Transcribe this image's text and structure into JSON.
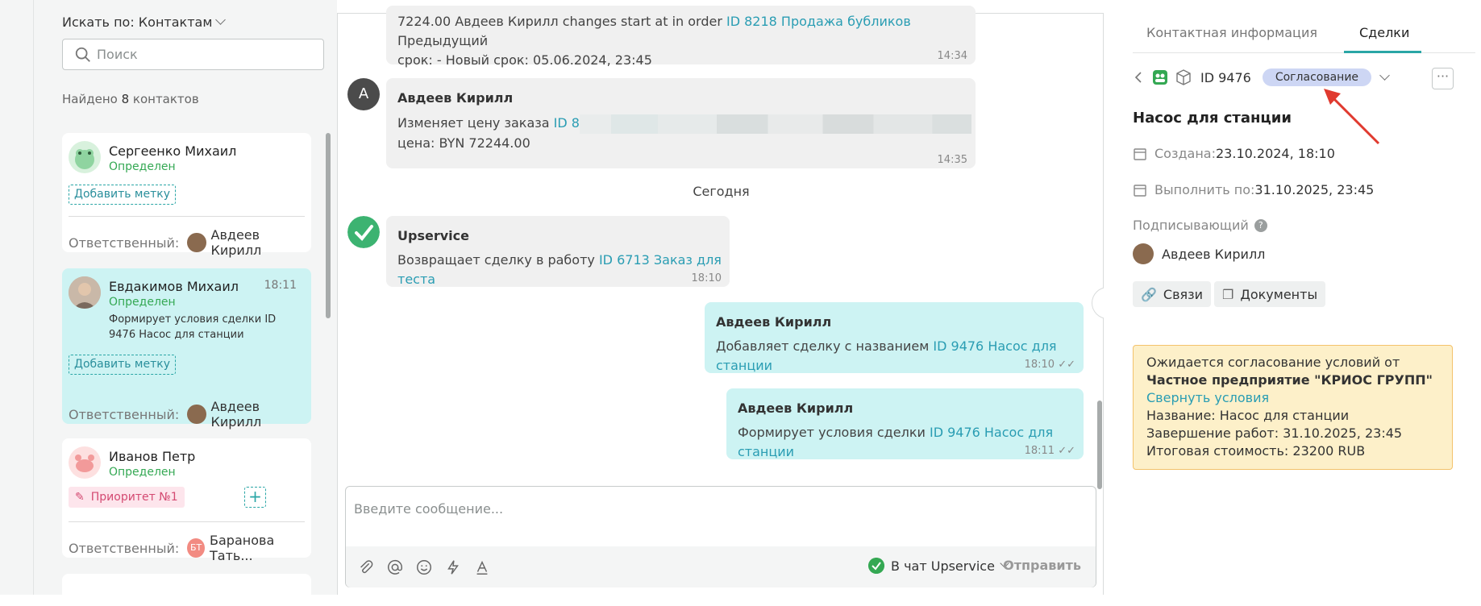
{
  "contacts": {
    "search_by": "Искать по: Контактам",
    "search_placeholder": "Поиск",
    "found_prefix": "Найдено ",
    "found_count": "8",
    "found_suffix": " контактов",
    "cards": [
      {
        "name": "Сергеенко Михаил",
        "status": "Определен",
        "tag_btn": "Добавить метку",
        "resp_label": "Ответственный:",
        "resp_name": "Авдеев Кирилл"
      },
      {
        "name": "Евдакимов Михаил",
        "status": "Определен",
        "time": "18:11",
        "message": "Формирует условия сделки ID 9476 Насос для станции",
        "tag_btn": "Добавить метку",
        "resp_label": "Ответственный:",
        "resp_name": "Авдеев Кирилл"
      },
      {
        "name": "Иванов Петр",
        "status": "Определен",
        "priority": "Приоритет №1",
        "plus": "+",
        "resp_label": "Ответственный:",
        "resp_initials": "БТ",
        "resp_name": "Баранова Тать..."
      }
    ]
  },
  "chat": {
    "messages": [
      {
        "text_a": "7224.00 Авдеев Кирилл changes start at in order ",
        "link": "ID 8218 Продажа бубликов",
        "text_b": " Предыдущий",
        "text_c": "срок: - Новый срок: 05.06.2024, 23:45",
        "time": "14:34"
      },
      {
        "avatar": "А",
        "author": "Авдеев Кирилл",
        "text_a": "Изменяет цену заказа ",
        "link": "ID 8",
        "text_c": "цена: BYN 72244.00",
        "time": "14:35"
      },
      {
        "author": "Upservice",
        "text_a": "Возвращает сделку в работу ",
        "link": "ID 6713 Заказ для теста",
        "time": "18:10"
      },
      {
        "author": "Авдеев Кирилл",
        "text_a": "Добавляет сделку с названием ",
        "link": "ID 9476 Насос для станции",
        "time": "18:10"
      },
      {
        "author": "Авдеев Кирилл",
        "text_a": "Формирует условия сделки ",
        "link": "ID 9476 Насос для станции",
        "time": "18:11"
      }
    ],
    "date_divider": "Сегодня",
    "compose_placeholder": "Введите сообщение...",
    "to_chat": "В чат Upservice",
    "send": "Отправить"
  },
  "right": {
    "tabs": [
      "Контактная информация",
      "Сделки"
    ],
    "deal_id": "ID 9476",
    "status_badge": "Согласование",
    "more": "···",
    "title": "Насос для станции",
    "created_label": "Создана: ",
    "created_value": "23.10.2024, 18:10",
    "due_label": "Выполнить по: ",
    "due_value": "31.10.2025, 23:45",
    "signers_label": "Подписывающий",
    "signer_name": "Авдеев Кирилл",
    "links_btn": "Связи",
    "docs_btn": "Документы",
    "notice": {
      "text": "Ожидается согласование условий от ",
      "company": "Частное предприятие \"КРИОС ГРУПП\"",
      "collapse_link": "Свернуть условия",
      "name_line": "Название: Насос для станции",
      "finish_line": "Завершение работ: 31.10.2025, 23:45",
      "cost_line": "Итоговая стоимость: 23200 RUB"
    }
  },
  "colors": {
    "accent": "#2aa6a6",
    "status_green": "#34a853",
    "annotation_arrow": "#e03a2f"
  }
}
